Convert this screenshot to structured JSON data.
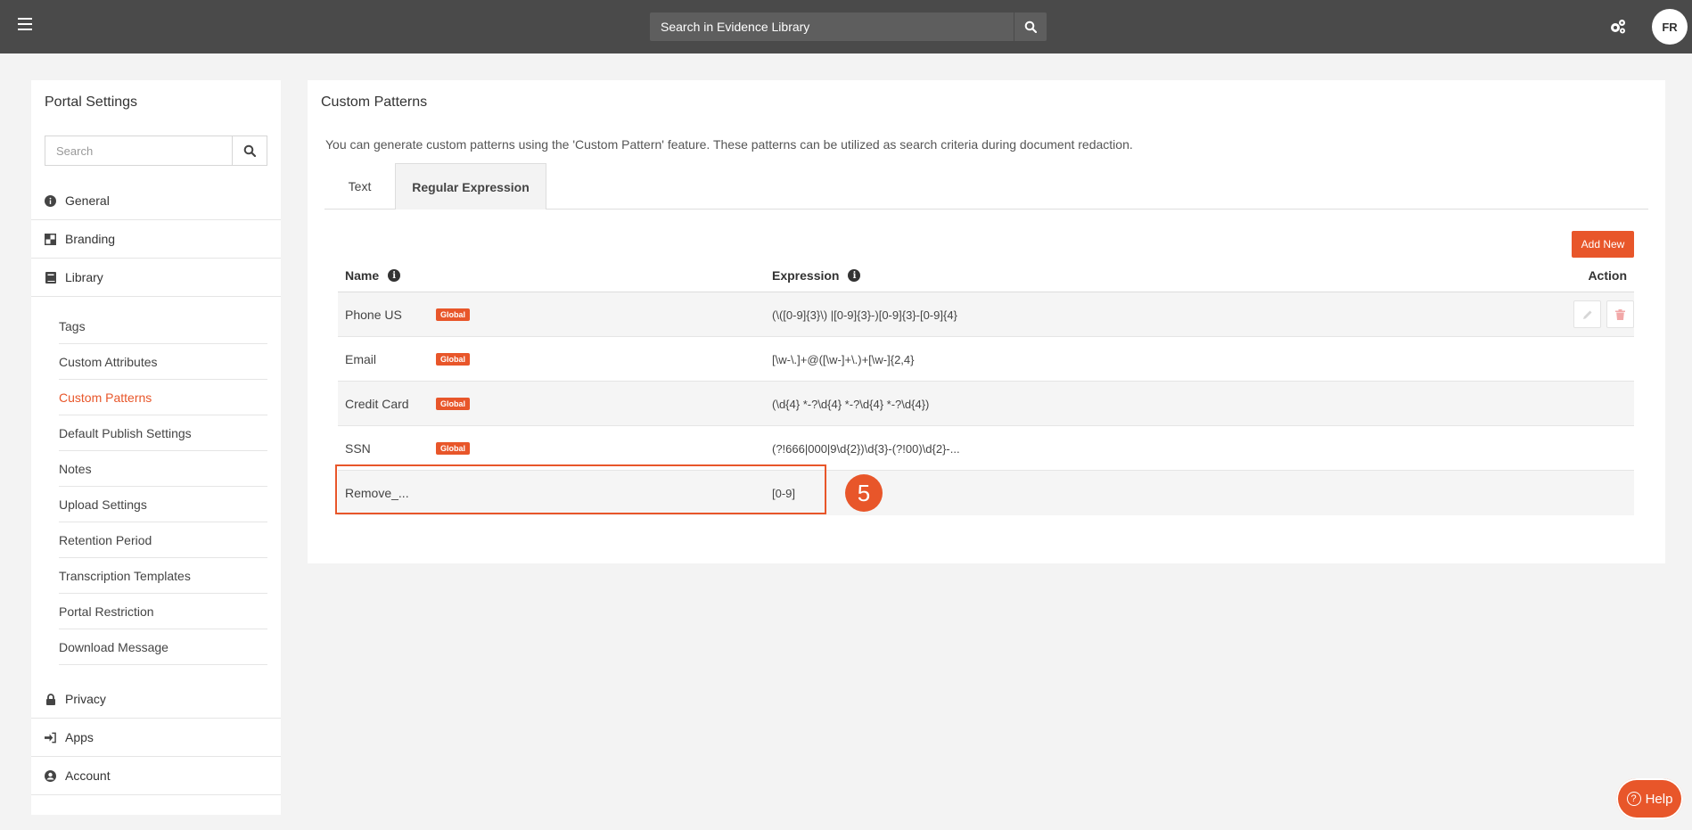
{
  "topbar": {
    "search_placeholder": "Search in Evidence Library",
    "avatar_initials": "FR"
  },
  "sidebar": {
    "title": "Portal Settings",
    "search_placeholder": "Search",
    "sections_top": [
      {
        "label": "General",
        "icon": "info-circle-icon"
      },
      {
        "label": "Branding",
        "icon": "branding-icon"
      },
      {
        "label": "Library",
        "icon": "book-icon"
      }
    ],
    "library_items": [
      "Tags",
      "Custom Attributes",
      "Custom Patterns",
      "Default Publish Settings",
      "Notes",
      "Upload Settings",
      "Retention Period",
      "Transcription Templates",
      "Portal Restriction",
      "Download Message"
    ],
    "active_item": "Custom Patterns",
    "sections_bottom": [
      {
        "label": "Privacy",
        "icon": "lock-icon"
      },
      {
        "label": "Apps",
        "icon": "sign-in-icon"
      },
      {
        "label": "Account",
        "icon": "user-circle-icon"
      }
    ]
  },
  "main": {
    "title": "Custom Patterns",
    "description": "You can generate custom patterns using the 'Custom Pattern' feature. These patterns can be utilized as search criteria during document redaction.",
    "tabs": [
      {
        "label": "Text",
        "active": false
      },
      {
        "label": "Regular Expression",
        "active": true
      }
    ],
    "add_button": "Add New",
    "table": {
      "headers": {
        "name": "Name",
        "expression": "Expression",
        "action": "Action"
      },
      "rows": [
        {
          "name": "Phone US",
          "badge": "Global",
          "expression": "(\\([0-9]{3}\\) |[0-9]{3}-)[0-9]{3}-[0-9]{4}"
        },
        {
          "name": "Email",
          "badge": "Global",
          "expression": "[\\w-\\.]+@([\\w-]+\\.)+[\\w-]{2,4}"
        },
        {
          "name": "Credit Card",
          "badge": "Global",
          "expression": "(\\d{4} *-?\\d{4} *-?\\d{4} *-?\\d{4})"
        },
        {
          "name": "SSN",
          "badge": "Global",
          "expression": "(?!666|000|9\\d{2})\\d{3}-(?!00)\\d{2}-..."
        },
        {
          "name": "Remove_...",
          "badge": "",
          "expression": "[0-9]"
        }
      ]
    }
  },
  "annotation": {
    "step_number": "5"
  },
  "help": {
    "label": "Help"
  },
  "colors": {
    "accent": "#e8562a",
    "topbar": "#4a4a4a"
  }
}
